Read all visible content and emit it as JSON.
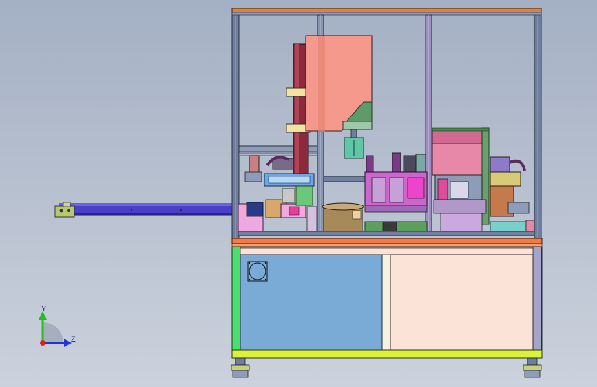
{
  "viewport": {
    "background_top": "#a4b0c4",
    "background_bottom": "#cbd2dd"
  },
  "triad": {
    "y_label": "Y",
    "z_label": "Z",
    "y_color": "#22c022",
    "z_color": "#2233dd",
    "x_color": "#e02020"
  },
  "model": {
    "frame_color": "#7c8ba6",
    "top_rail_color": "#e0823a",
    "belt_color": "#4a3fc8",
    "cabinet_left_color": "#7aaad6",
    "cabinet_right_color": "#fbe3d8",
    "hood_color": "#f4998c",
    "column_color": "#8a2a3a",
    "base_rail_color": "#dcf23a"
  }
}
